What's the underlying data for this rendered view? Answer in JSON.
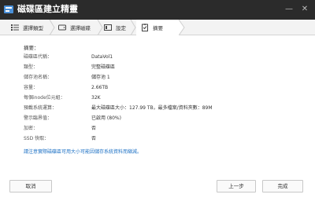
{
  "window": {
    "title": "磁碟區建立精靈",
    "icon": "disk-wizard-icon",
    "minimize_icon": "minimize-icon",
    "close_icon": "close-icon"
  },
  "steps": [
    {
      "label": "選擇類型",
      "icon": "list-settings-icon"
    },
    {
      "label": "選擇磁碟",
      "icon": "hard-disk-icon"
    },
    {
      "label": "設定",
      "icon": "settings-panel-icon"
    },
    {
      "label": "摘要",
      "icon": "summary-clipboard-icon"
    }
  ],
  "summary": {
    "heading": "摘要：",
    "rows": [
      {
        "label": "磁碟區代稱：",
        "value": "DataVol1"
      },
      {
        "label": "類型：",
        "value": "完整磁碟區"
      },
      {
        "label": "儲存池名稱：",
        "value": "儲存池 1"
      },
      {
        "label": "容量：",
        "value": "2.66TB"
      },
      {
        "label": "每個inode位元組：",
        "value": "32K"
      },
      {
        "label": "預載系統運算：",
        "value": "最大磁碟區大小：127.99 TB，最多檔案/資料夾數：89M"
      },
      {
        "label": "警示臨界值：",
        "value": "已啟用 (80%)"
      },
      {
        "label": "加密：",
        "value": "否"
      },
      {
        "label": "SSD 快取：",
        "value": "否"
      }
    ],
    "note": "請注意實際磁碟區可用大小可能因儲存系統資料而縮減。"
  },
  "footer": {
    "cancel_label": "取消",
    "back_label": "上一步",
    "finish_label": "完成"
  },
  "colors": {
    "titlebar": "#2b2b2b",
    "stepbar": "#f3f3f3",
    "note": "#1a6fc4"
  }
}
